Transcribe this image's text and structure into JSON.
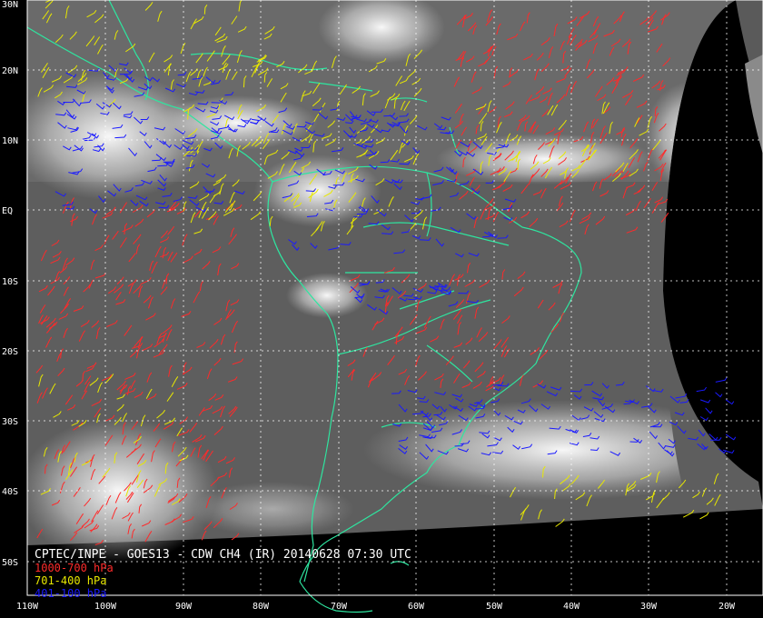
{
  "title": "CPTEC/INPE - GOES13 - CDW CH4 (IR) 20140628 07:30 UTC",
  "legend": [
    {
      "label": "1000-700 hPa",
      "color": "#ff2a2a"
    },
    {
      "label": "701-400 hPa",
      "color": "#e8e800"
    },
    {
      "label": "401-100 hPa",
      "color": "#1a1aff"
    }
  ],
  "lat_labels": [
    "30N",
    "20N",
    "10N",
    "EQ",
    "10S",
    "20S",
    "30S",
    "40S",
    "50S"
  ],
  "lon_labels": [
    "110W",
    "100W",
    "90W",
    "80W",
    "70W",
    "60W",
    "50W",
    "40W",
    "30W",
    "20W"
  ],
  "colors": {
    "coastline": "#2ee6a0",
    "grid": "#ffffff",
    "background": "#000000",
    "frame": "#ffffff"
  }
}
